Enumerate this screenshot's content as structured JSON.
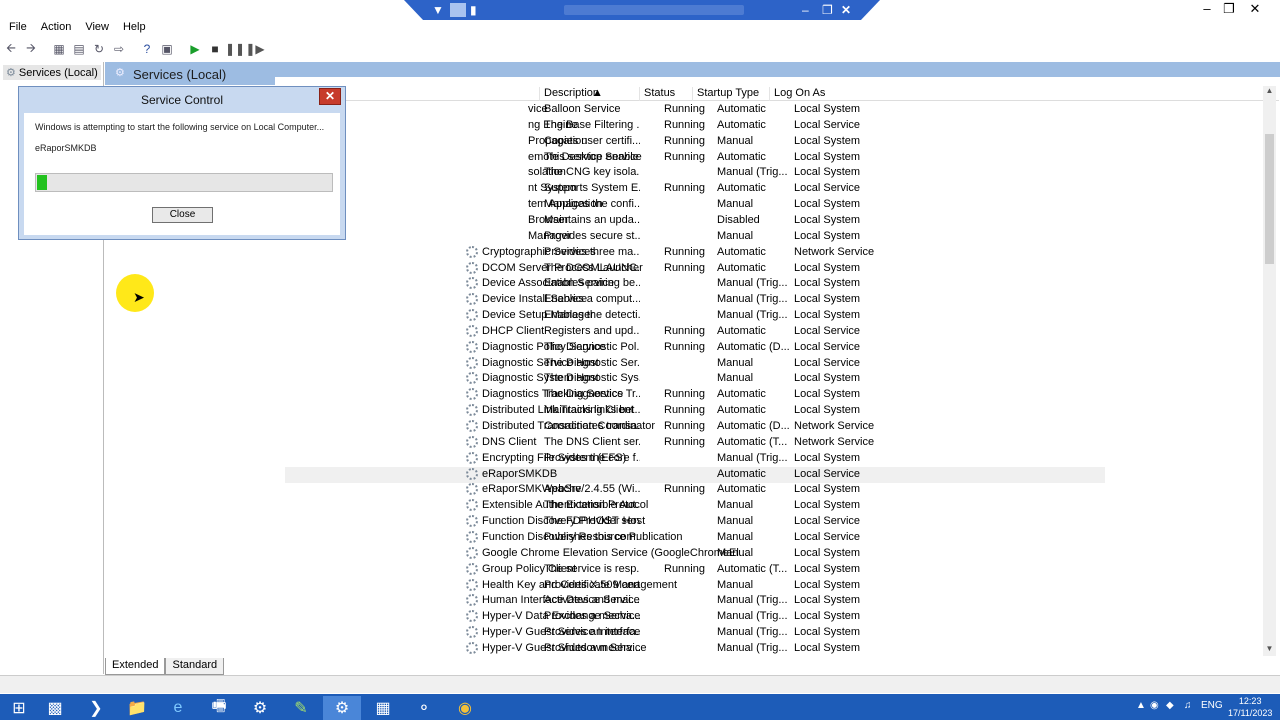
{
  "menu": [
    "File",
    "Action",
    "View",
    "Help"
  ],
  "tree": {
    "label": "Services (Local)"
  },
  "main": {
    "title": "Services (Local)"
  },
  "columns": [
    "Description",
    "Status",
    "Startup Type",
    "Log On As"
  ],
  "rows": [
    {
      "name": "vice",
      "description": "Balloon Service",
      "status": "Running",
      "startup": "Automatic",
      "logon": "Local System"
    },
    {
      "name": "ng Engine",
      "description": "The Base Filtering ...",
      "status": "Running",
      "startup": "Automatic",
      "logon": "Local Service"
    },
    {
      "name": "Propagation",
      "description": "Copies user certifi...",
      "status": "Running",
      "startup": "Manual",
      "logon": "Local System"
    },
    {
      "name": "emote Desktop Service",
      "description": "This service enable...",
      "status": "Running",
      "startup": "Automatic",
      "logon": "Local System"
    },
    {
      "name": "solation",
      "description": "The CNG key isola...",
      "status": "",
      "startup": "Manual (Trig...",
      "logon": "Local System"
    },
    {
      "name": "nt System",
      "description": "Supports System E...",
      "status": "Running",
      "startup": "Automatic",
      "logon": "Local Service"
    },
    {
      "name": "tem Application",
      "description": "Manages the confi...",
      "status": "",
      "startup": "Manual",
      "logon": "Local System"
    },
    {
      "name": "Browser",
      "description": "Maintains an upda...",
      "status": "",
      "startup": "Disabled",
      "logon": "Local System"
    },
    {
      "name": "Manager",
      "description": "Provides secure st...",
      "status": "",
      "startup": "Manual",
      "logon": "Local System"
    },
    {
      "name": "Cryptographic Services",
      "description": "Provides three ma...",
      "status": "Running",
      "startup": "Automatic",
      "logon": "Network Service"
    },
    {
      "name": "DCOM Server Process Launcher",
      "description": "The DCOMLAUNC...",
      "status": "Running",
      "startup": "Automatic",
      "logon": "Local System"
    },
    {
      "name": "Device Association Service",
      "description": "Enables pairing be...",
      "status": "",
      "startup": "Manual (Trig...",
      "logon": "Local System"
    },
    {
      "name": "Device Install Service",
      "description": "Enables a comput...",
      "status": "",
      "startup": "Manual (Trig...",
      "logon": "Local System"
    },
    {
      "name": "Device Setup Manager",
      "description": "Enables the detecti...",
      "status": "",
      "startup": "Manual (Trig...",
      "logon": "Local System"
    },
    {
      "name": "DHCP Client",
      "description": "Registers and upd...",
      "status": "Running",
      "startup": "Automatic",
      "logon": "Local Service"
    },
    {
      "name": "Diagnostic Policy Service",
      "description": "The Diagnostic Pol...",
      "status": "Running",
      "startup": "Automatic (D...",
      "logon": "Local Service"
    },
    {
      "name": "Diagnostic Service Host",
      "description": "The Diagnostic Ser...",
      "status": "",
      "startup": "Manual",
      "logon": "Local Service"
    },
    {
      "name": "Diagnostic System Host",
      "description": "The Diagnostic Sys...",
      "status": "",
      "startup": "Manual",
      "logon": "Local System"
    },
    {
      "name": "Diagnostics Tracking Service",
      "description": "The Diagnostics Tr...",
      "status": "Running",
      "startup": "Automatic",
      "logon": "Local System"
    },
    {
      "name": "Distributed Link Tracking Client",
      "description": "Maintains links bet...",
      "status": "Running",
      "startup": "Automatic",
      "logon": "Local System"
    },
    {
      "name": "Distributed Transaction Coordinator",
      "description": "Coordinates transa...",
      "status": "Running",
      "startup": "Automatic (D...",
      "logon": "Network Service"
    },
    {
      "name": "DNS Client",
      "description": "The DNS Client ser...",
      "status": "Running",
      "startup": "Automatic (T...",
      "logon": "Network Service"
    },
    {
      "name": "Encrypting File System (EFS)",
      "description": "Provides the core f...",
      "status": "",
      "startup": "Manual (Trig...",
      "logon": "Local System"
    },
    {
      "name": "eRaporSMKDB",
      "description": "",
      "status": "",
      "startup": "Automatic",
      "logon": "Local Service",
      "selected": true
    },
    {
      "name": "eRaporSMKWebSrv",
      "description": "Apache/2.4.55 (Wi...",
      "status": "Running",
      "startup": "Automatic",
      "logon": "Local System"
    },
    {
      "name": "Extensible Authentication Protocol",
      "description": "The Extensible Aut...",
      "status": "",
      "startup": "Manual",
      "logon": "Local System"
    },
    {
      "name": "Function Discovery Provider Host",
      "description": "The FDPHOST serv...",
      "status": "",
      "startup": "Manual",
      "logon": "Local Service"
    },
    {
      "name": "Function Discovery Resource Publication",
      "description": "Publishes this com...",
      "status": "",
      "startup": "Manual",
      "logon": "Local Service"
    },
    {
      "name": "Google Chrome Elevation Service (GoogleChromeEl...",
      "description": "",
      "status": "",
      "startup": "Manual",
      "logon": "Local System"
    },
    {
      "name": "Group Policy Client",
      "description": "The service is resp...",
      "status": "Running",
      "startup": "Automatic (T...",
      "logon": "Local System"
    },
    {
      "name": "Health Key and Certificate Management",
      "description": "Provides X.509 cert...",
      "status": "",
      "startup": "Manual",
      "logon": "Local System"
    },
    {
      "name": "Human Interface Device Service",
      "description": "Activates and mai...",
      "status": "",
      "startup": "Manual (Trig...",
      "logon": "Local System"
    },
    {
      "name": "Hyper-V Data Exchange Service",
      "description": "Provides a mecha...",
      "status": "",
      "startup": "Manual (Trig...",
      "logon": "Local System"
    },
    {
      "name": "Hyper-V Guest Service Interface",
      "description": "Provides an interfa...",
      "status": "",
      "startup": "Manual (Trig...",
      "logon": "Local System"
    },
    {
      "name": "Hyper-V Guest Shutdown Service",
      "description": "Provides a mecha...",
      "status": "",
      "startup": "Manual (Trig...",
      "logon": "Local System"
    }
  ],
  "tabs": [
    "Extended",
    "Standard"
  ],
  "dialog": {
    "title": "Service Control",
    "message": "Windows is attempting to start the following service on Local Computer...",
    "service": "eRaporSMKDB",
    "progress": 0.03,
    "close_label": "Close",
    "progress_color": "#23c21f"
  },
  "tray": {
    "lang": "ENG",
    "time": "12:23",
    "date": "17/11/2023"
  },
  "colors": {
    "taskbar": "#1d5cb8",
    "header": "#9dbce2",
    "rdp_bar": "#2d63c8"
  }
}
